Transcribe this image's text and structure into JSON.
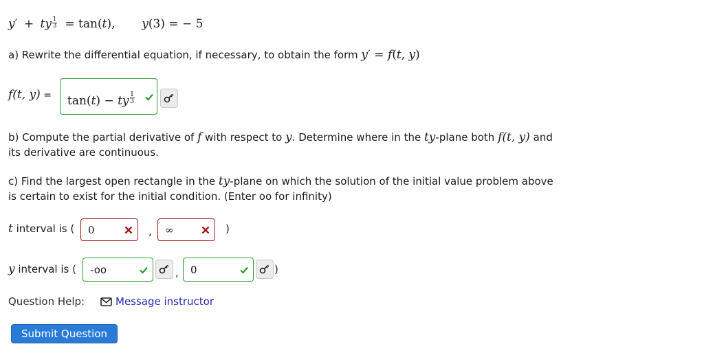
{
  "problem": {
    "equation_lhs_y": "y",
    "equation_prime": "′",
    "equation_plus": "+",
    "equation_ty": "ty",
    "exponent_num": "1",
    "exponent_den": "3",
    "equation_rhs": "= tan(",
    "equation_t": "t",
    "equation_rhs_close": "),",
    "initial_condition_y": "y",
    "initial_condition_arg": "(3) = − 5"
  },
  "part_a": {
    "text": "a) Rewrite the differential equation, if necessary, to obtain the form",
    "form_y": "y",
    "form_prime": "′",
    "form_eq": " = ",
    "form_f": "f",
    "form_args_open": "(",
    "form_t": "t",
    "form_comma": ", ",
    "form_y2": "y",
    "form_args_close": ")",
    "label_f": "f",
    "label_args": "(t, y)",
    "label_eq": " =",
    "answer": {
      "tan": "tan(",
      "t": "t",
      "close_minus": ") − ",
      "ty": "ty",
      "exp_num": "1",
      "exp_den": "3",
      "status": "correct"
    }
  },
  "part_b": {
    "line1_pre": "b) Compute the partial derivative of ",
    "line1_f": "f",
    "line1_mid": " with respect to ",
    "line1_y": "y",
    "line1_mid2": ". Determine where in the ",
    "line1_ty": "ty",
    "line1_mid3": "-plane both ",
    "line1_fty": "f(t, y)",
    "line1_end": " and",
    "line2": "its derivative are continuous."
  },
  "part_c": {
    "line1_pre": "c) Find the largest open rectangle in the ",
    "line1_ty": "ty",
    "line1_end": "-plane on which the solution of the initial value problem above",
    "line2": "is certain to exist for the initial condition. (Enter oo for infinity)",
    "t_interval": {
      "label_var": "t",
      "label_text": " interval is (",
      "lower": {
        "value": "0",
        "status": "incorrect"
      },
      "comma": ",",
      "upper": {
        "value": "∞",
        "status": "incorrect"
      },
      "close": ")"
    },
    "y_interval": {
      "label_var": "y",
      "label_text": " interval is (",
      "lower": {
        "value": "-oo",
        "status": "correct"
      },
      "comma": ",",
      "upper": {
        "value": "0",
        "status": "correct"
      },
      "close": ")"
    }
  },
  "help": {
    "label": "Question Help:",
    "message_icon": "envelope-icon",
    "message_link": "Message instructor"
  },
  "submit": {
    "label": "Submit Question"
  },
  "colors": {
    "correct": "#2b9a2b",
    "incorrect": "#a01a1a",
    "link": "#2a2ab8",
    "button": "#2a7bd6"
  }
}
